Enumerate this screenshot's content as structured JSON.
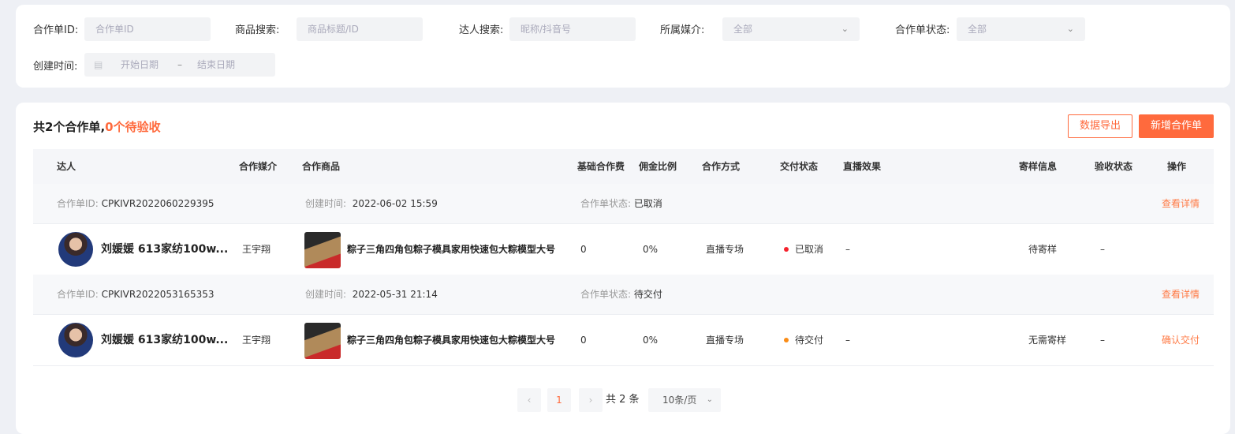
{
  "filters": {
    "order_id_label": "合作单ID:",
    "order_id_placeholder": "合作单ID",
    "product_label": "商品搜索:",
    "product_placeholder": "商品标题/ID",
    "talent_label": "达人搜索:",
    "talent_placeholder": "昵称/抖音号",
    "media_label": "所属媒介:",
    "media_value": "全部",
    "status_label": "合作单状态:",
    "status_value": "全部",
    "created_label": "创建时间:",
    "start_placeholder": "开始日期",
    "date_separator": "–",
    "end_placeholder": "结束日期"
  },
  "summary": {
    "total_text": "共2个合作单,",
    "pending_text": "0个待验收"
  },
  "actions": {
    "export_label": "数据导出",
    "add_label": "新增合作单"
  },
  "table": {
    "headers": [
      "达人",
      "合作媒介",
      "合作商品",
      "基础合作费",
      "佣金比例",
      "合作方式",
      "交付状态",
      "直播效果",
      "寄样信息",
      "验收状态",
      "操作"
    ],
    "rows": [
      {
        "meta_id_label": "合作单ID:",
        "meta_id": "CPKIVR2022060229395",
        "meta_time_label": "创建时间:",
        "meta_time": "2022-06-02 15:59",
        "meta_status_label": "合作单状态:",
        "meta_status": "已取消",
        "detail_link": "查看详情",
        "talent": "刘媛媛 613家纺100w...",
        "media": "王宇翔",
        "product": "粽子三角四角包粽子模具家用快速包大粽模型大号",
        "base_fee": "0",
        "commission": "0%",
        "coop_mode": "直播专场",
        "delivery_status": "已取消",
        "delivery_color": "#f5222d",
        "live_effect": "–",
        "sample_info": "待寄样",
        "acceptance": "–",
        "action": ""
      },
      {
        "meta_id_label": "合作单ID:",
        "meta_id": "CPKIVR2022053165353",
        "meta_time_label": "创建时间:",
        "meta_time": "2022-05-31 21:14",
        "meta_status_label": "合作单状态:",
        "meta_status": "待交付",
        "detail_link": "查看详情",
        "talent": "刘媛媛 613家纺100w...",
        "media": "王宇翔",
        "product": "粽子三角四角包粽子模具家用快速包大粽模型大号",
        "base_fee": "0",
        "commission": "0%",
        "coop_mode": "直播专场",
        "delivery_status": "待交付",
        "delivery_color": "#fa8c16",
        "live_effect": "–",
        "sample_info": "无需寄样",
        "acceptance": "–",
        "action": "确认交付"
      }
    ]
  },
  "pagination": {
    "prev": "‹",
    "current": "1",
    "next": "›",
    "total": "共 2 条",
    "page_size": "10条/页"
  }
}
